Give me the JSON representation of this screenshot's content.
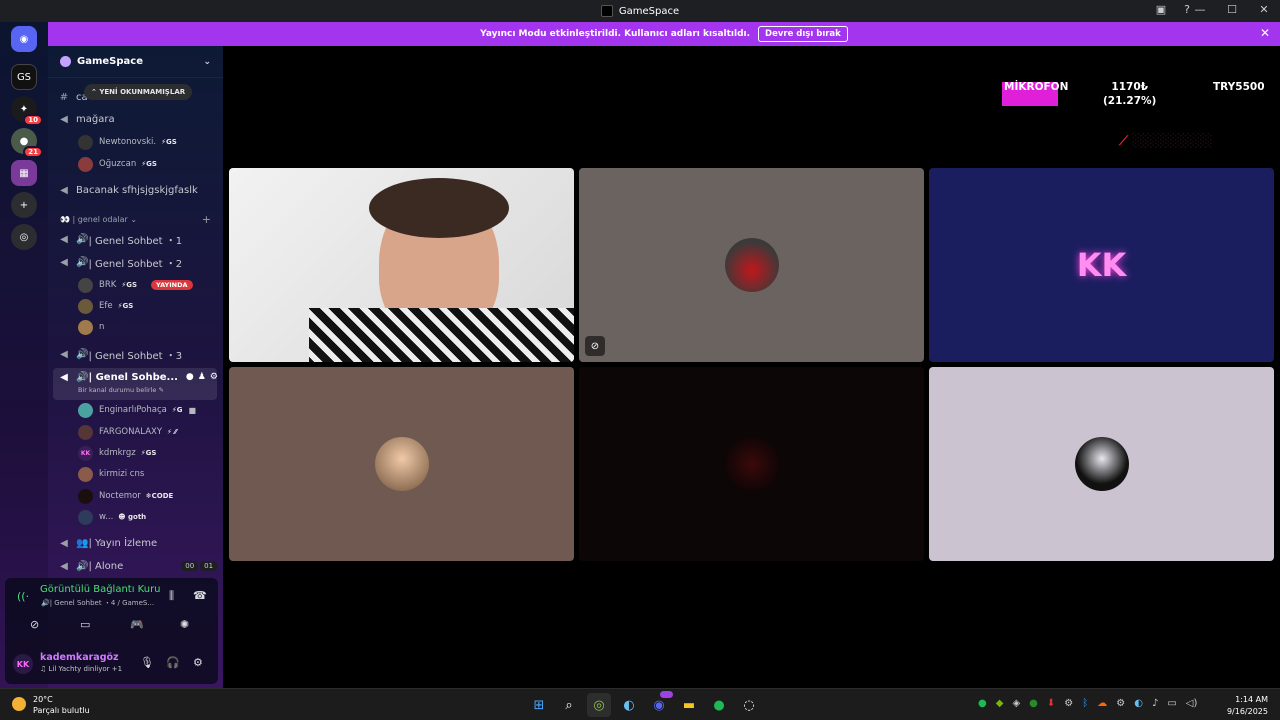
{
  "window": {
    "title": "GameSpace",
    "help_icon": "?",
    "minimize": "—",
    "maximize": "☐",
    "close": "✕"
  },
  "banner": {
    "text": "Yayıncı Modu etkinleştirildi. Kullanıcı adları kısaltıldı.",
    "button": "Devre dışı bırak",
    "close": "✕"
  },
  "rail": {
    "badges": [
      "10",
      "21"
    ]
  },
  "sidebar": {
    "guild_name": "GameSpace",
    "unread_pill": "YENİ OKUNMAMIŞLAR",
    "channels": {
      "text_partial": "ca",
      "magara": "mağara",
      "bacanak": "Bacanak sfhjsjgskjgfaslk",
      "category": "| genel odalar",
      "genel1": "| Genel Sohbet ・1",
      "genel2": "| Genel Sohbet ・2",
      "genel3": "| Genel Sohbet ・3",
      "genel4": "| Genel Sohbe...",
      "genel4_status": "Bir kanal durumu belirle",
      "yayin": "| Yayın İzleme",
      "alone": "| Alone",
      "alone_counts": [
        "00",
        "01"
      ]
    },
    "users_magara": [
      {
        "name": "Newtonovski.",
        "tag": "GS"
      },
      {
        "name": "Oğuzcan",
        "tag": "GS"
      }
    ],
    "users_genel2": [
      {
        "name": "BRK",
        "tag": "GS",
        "live": "YAYINDA"
      },
      {
        "name": "Efe",
        "tag": "GS"
      },
      {
        "name": "n",
        "tag": ""
      }
    ],
    "users_genel4": [
      {
        "name": "EnginarlıPohaça",
        "tag": "G"
      },
      {
        "name": "FARGONALAXY",
        "tag": ""
      },
      {
        "name": "kdmkrgz",
        "tag": "GS"
      },
      {
        "name": "kirmizi cns",
        "tag": ""
      },
      {
        "name": "Noctemor",
        "tag": "CODE"
      },
      {
        "name": "w...",
        "tag": "goth"
      }
    ]
  },
  "voice_panel": {
    "status": "Görüntülü Bağlantı Kuruldu",
    "channel": "| Genel Sohbet ・4 / GameS..."
  },
  "userbar": {
    "initials": "KK",
    "username": "kademkaragöz",
    "activity": "Lil Yachty dinliyor +1"
  },
  "stream_overlay": {
    "label": "MİKROFON",
    "amount": "1170₺",
    "percent": "(21.27%)",
    "goal": "TRY5500",
    "progress_fraction": 0.2127
  },
  "tiles": {
    "kk_initials": "KK"
  },
  "taskbar": {
    "temperature": "20°C",
    "weather": "Parçalı bulutlu",
    "discord_badge": "9+",
    "time": "1:14 AM",
    "date": "9/16/2025"
  }
}
